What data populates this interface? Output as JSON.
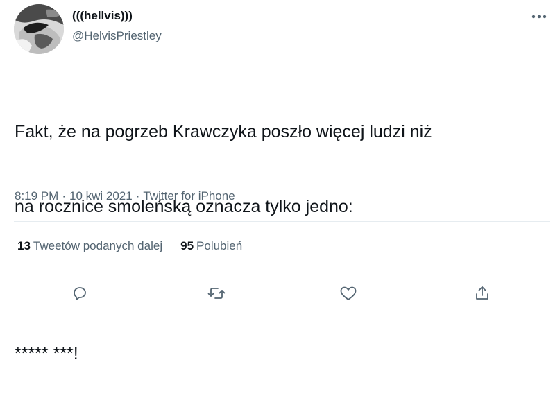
{
  "author": {
    "display_name": "(((hellvis)))",
    "handle": "@HelvisPriestley",
    "avatar_icon": "user-avatar"
  },
  "tweet": {
    "lines": [
      "Fakt, że na pogrzeb Krawczyka poszło więcej ludzi niż",
      "na rocznice smoleńską oznacza tylko jedno:",
      "***** ***!"
    ]
  },
  "meta": {
    "time": "8:19 PM",
    "separator": "·",
    "date": "10 kwi 2021",
    "source": "Twitter for iPhone"
  },
  "stats": {
    "retweets_count": "13",
    "retweets_label": "Tweetów podanych dalej",
    "likes_count": "95",
    "likes_label": "Polubień"
  },
  "colors": {
    "text": "#0f1419",
    "secondary": "#536471",
    "divider": "#e6ecf0"
  },
  "icons": {
    "more": "more-icon",
    "reply": "reply-icon",
    "retweet": "retweet-icon",
    "like": "like-icon",
    "share": "share-icon"
  }
}
